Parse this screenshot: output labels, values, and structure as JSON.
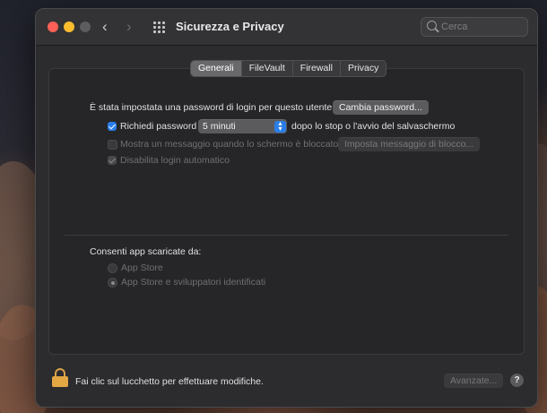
{
  "window": {
    "title": "Sicurezza e Privacy",
    "search_placeholder": "Cerca",
    "nav_back": "‹",
    "nav_forward": "›"
  },
  "tabs": [
    {
      "label": "Generali",
      "active": true
    },
    {
      "label": "FileVault",
      "active": false
    },
    {
      "label": "Firewall",
      "active": false
    },
    {
      "label": "Privacy",
      "active": false
    }
  ],
  "general": {
    "password_set_text": "È stata impostata una password di login per questo utente",
    "change_password_button": "Cambia password...",
    "require_password_label": "Richiedi password",
    "require_password_checked": true,
    "require_password_delay": "5 minuti",
    "require_password_suffix": "dopo lo stop o l'avvio del salvaschermo",
    "show_message_label": "Mostra un messaggio quando lo schermo è bloccato",
    "show_message_checked": false,
    "set_message_button": "Imposta messaggio di blocco...",
    "disable_autologin_label": "Disabilita login automatico",
    "disable_autologin_checked": true
  },
  "downloads": {
    "heading": "Consenti app scaricate da:",
    "options": [
      {
        "label": "App Store",
        "selected": false
      },
      {
        "label": "App Store e sviluppatori identificati",
        "selected": true
      }
    ]
  },
  "footer": {
    "lock_text": "Fai clic sul lucchetto per effettuare modifiche.",
    "advanced_button": "Avanzate...",
    "help_button": "?"
  },
  "colors": {
    "accent": "#2a7ee8",
    "lock": "#e3a843",
    "close": "#fe5f57",
    "minimize": "#febc2e"
  }
}
